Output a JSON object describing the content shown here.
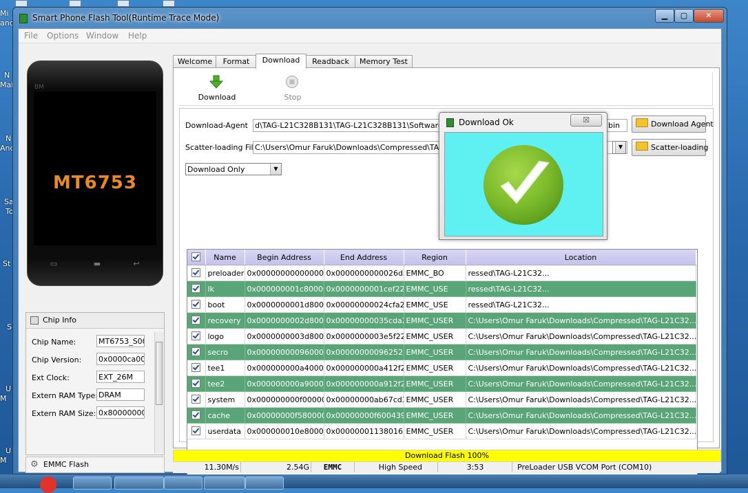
{
  "window": {
    "title": "Smart Phone Flash Tool(Runtime Trace Mode)",
    "controls": {
      "minimize": "▁",
      "maximize": "▢",
      "close": "✕"
    }
  },
  "menu": [
    "File",
    "Options",
    "Window",
    "Help"
  ],
  "phone": {
    "brand": "BM",
    "chip_name": "MT6753"
  },
  "chip_info": {
    "title": "Chip Info",
    "rows": [
      {
        "label": "Chip Name:",
        "value": "MT6753_S00"
      },
      {
        "label": "Chip Version:",
        "value": "0x0000ca00"
      },
      {
        "label": "Ext Clock:",
        "value": "EXT_26M"
      },
      {
        "label": "Extern RAM Type:",
        "value": "DRAM"
      },
      {
        "label": "Extern RAM Size:",
        "value": "0x80000000"
      }
    ],
    "footer": "EMMC Flash"
  },
  "tabs": [
    "Welcome",
    "Format",
    "Download",
    "Readback",
    "Memory Test"
  ],
  "toolbar": {
    "download": "Download",
    "stop": "Stop"
  },
  "fields": {
    "download_agent_label": "Download-Agent",
    "download_agent_path": "d\\TAG-L21C328B131\\TAG-L21C328B131\\Software\\upgrad",
    "download_agent_suffix": "bin",
    "download_agent_button": "Download Agent",
    "scatter_label": "Scatter-loading File",
    "scatter_path": "C:\\Users\\Omur Faruk\\Downloads\\Compressed\\TAG-L21C3",
    "scatter_button": "Scatter-loading",
    "mode": "Download Only"
  },
  "table": {
    "headers": [
      "Name",
      "Begin Address",
      "End Address",
      "Region",
      "Location"
    ],
    "rows": [
      {
        "name": "preloader",
        "begin": "0x0000000000000000",
        "end": "0x0000000000026dab",
        "region": "EMMC_BO",
        "location": "ressed\\TAG-L21C32..."
      },
      {
        "name": "lk",
        "begin": "0x000000001c80000",
        "end": "0x0000000001cef22b",
        "region": "EMMC_USE",
        "location": "ressed\\TAG-L21C32..."
      },
      {
        "name": "boot",
        "begin": "0x0000000001d80000",
        "end": "0x00000000024cfa2b",
        "region": "EMMC_USE",
        "location": "ressed\\TAG-L21C32..."
      },
      {
        "name": "recovery",
        "begin": "0x0000000002d80000",
        "end": "0x00000000035cda2b",
        "region": "EMMC_USER",
        "location": "C:\\Users\\Omur Faruk\\Downloads\\Compressed\\TAG-L21C32..."
      },
      {
        "name": "logo",
        "begin": "0x0000000003d80000",
        "end": "0x0000000003e5f22b",
        "region": "EMMC_USER",
        "location": "C:\\Users\\Omur Faruk\\Downloads\\Compressed\\TAG-L21C32..."
      },
      {
        "name": "secro",
        "begin": "0x0000000009600000",
        "end": "0x000000000962522b",
        "region": "EMMC_USER",
        "location": "C:\\Users\\Omur Faruk\\Downloads\\Compressed\\TAG-L21C32..."
      },
      {
        "name": "tee1",
        "begin": "0x000000000a400000",
        "end": "0x000000000a412f2b",
        "region": "EMMC_USER",
        "location": "C:\\Users\\Omur Faruk\\Downloads\\Compressed\\TAG-L21C32..."
      },
      {
        "name": "tee2",
        "begin": "0x000000000a900000",
        "end": "0x000000000a912f2b",
        "region": "EMMC_USER",
        "location": "C:\\Users\\Omur Faruk\\Downloads\\Compressed\\TAG-L21C32..."
      },
      {
        "name": "system",
        "begin": "0x000000000f000000",
        "end": "0x00000000ab67cd3f",
        "region": "EMMC_USER",
        "location": "C:\\Users\\Omur Faruk\\Downloads\\Compressed\\TAG-L21C32..."
      },
      {
        "name": "cache",
        "begin": "0x00000000f5800000",
        "end": "0x00000000f600439f",
        "region": "EMMC_USER",
        "location": "C:\\Users\\Omur Faruk\\Downloads\\Compressed\\TAG-L21C32..."
      },
      {
        "name": "userdata",
        "begin": "0x000000010e800000",
        "end": "0x00000001138016b7",
        "region": "EMMC_USER",
        "location": "C:\\Users\\Omur Faruk\\Downloads\\Compressed\\TAG-L21C32..."
      }
    ]
  },
  "progress": {
    "label": "Download Flash 100%",
    "percent": 100
  },
  "status": {
    "speed": "11.30M/s",
    "size": "2.54G",
    "storage": "EMMC",
    "usb": "High Speed",
    "time": "3:53",
    "port": "PreLoader USB VCOM Port (COM10)"
  },
  "dialog": {
    "title": "Download Ok",
    "close": "☒"
  },
  "desktop_fragments": [
    "Mi",
    "and",
    "N",
    "Mai",
    "N",
    "And",
    "Sa",
    "To",
    "St",
    "S",
    "U",
    "M",
    "U",
    "M"
  ],
  "colors": {
    "progress": "#ffff00",
    "row_highlight": "#5aa578",
    "dialog_bg": "#5ff0f1",
    "check": "#78b82a",
    "chip_text": "#e8892a"
  }
}
